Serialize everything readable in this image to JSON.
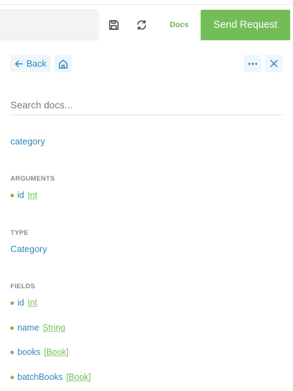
{
  "toolbar": {
    "docs_label": "Docs",
    "send_label": "Send Request"
  },
  "nav": {
    "back_label": "Back"
  },
  "search": {
    "placeholder": "Search docs..."
  },
  "breadcrumb": "category",
  "arguments": {
    "title": "ARGUMENTS",
    "items": [
      {
        "name": "id",
        "type": "Int"
      }
    ]
  },
  "type_section": {
    "title": "TYPE",
    "value": "Category"
  },
  "fields": {
    "title": "FIELDS",
    "items": [
      {
        "name": "id",
        "type": "Int"
      },
      {
        "name": "name",
        "type": "String"
      },
      {
        "name": "books",
        "type": "[Book]"
      },
      {
        "name": "batchBooks",
        "type": "[Book]"
      }
    ]
  },
  "colors": {
    "accent_green": "#73bd58",
    "link_blue": "#2f86b9"
  }
}
